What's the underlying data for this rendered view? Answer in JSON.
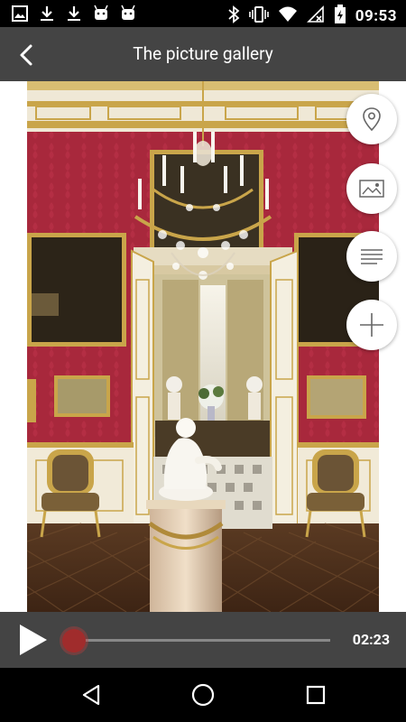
{
  "status_bar": {
    "time": "09:53",
    "left_icons": [
      "image-icon",
      "download-icon",
      "download-icon",
      "android-icon",
      "android-icon"
    ],
    "right_icons": [
      "bluetooth-icon",
      "vibrate-icon",
      "wifi-icon",
      "no-signal-icon",
      "battery-charging-icon"
    ]
  },
  "header": {
    "title": "The picture gallery",
    "back_icon": "chevron-left-icon"
  },
  "fabs": [
    {
      "icon": "location-pin-icon"
    },
    {
      "icon": "image-icon"
    },
    {
      "icon": "text-lines-icon"
    },
    {
      "icon": "plus-icon"
    }
  ],
  "player": {
    "duration": "02:23",
    "progress": 0.0,
    "accent": "#a02c2c"
  },
  "nav": {
    "buttons": [
      "back-triangle-icon",
      "home-circle-icon",
      "recents-square-icon"
    ]
  },
  "colors": {
    "header_bg": "#444444",
    "wall_red": "#a8283c",
    "gold": "#c9a54a"
  }
}
